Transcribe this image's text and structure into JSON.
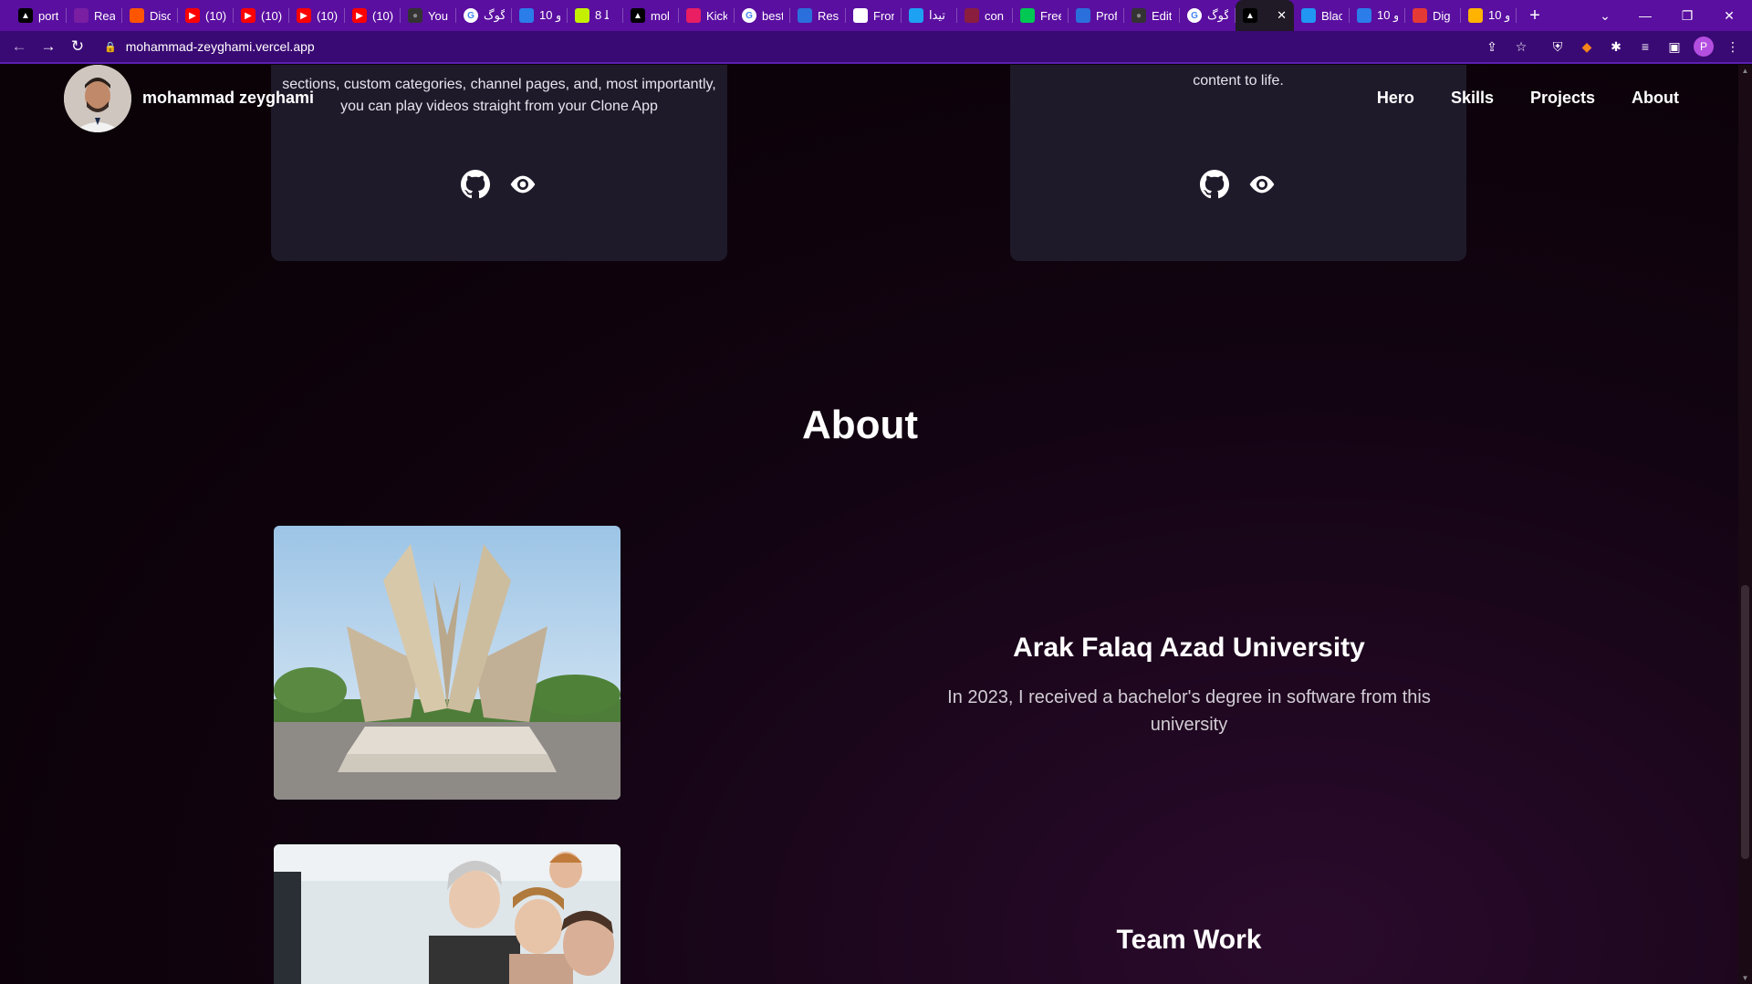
{
  "browser": {
    "tabs": [
      {
        "title": "port",
        "color": "#000000",
        "icon": "vercel-icon"
      },
      {
        "title": "Reac",
        "color": "#7a1fa2",
        "icon": "react-icon"
      },
      {
        "title": "Disc",
        "color": "#ff5500",
        "icon": "soundcloud-icon"
      },
      {
        "title": "(10)",
        "color": "#ff0000",
        "icon": "youtube-icon"
      },
      {
        "title": "(10)",
        "color": "#ff0000",
        "icon": "youtube-icon"
      },
      {
        "title": "(10)",
        "color": "#ff0000",
        "icon": "youtube-icon"
      },
      {
        "title": "(10)",
        "color": "#ff0000",
        "icon": "youtube-icon"
      },
      {
        "title": "You",
        "color": "#333333",
        "icon": "github-icon"
      },
      {
        "title": "گوگ",
        "color": "#ffffff",
        "icon": "google-icon"
      },
      {
        "title": "10 ﻭ",
        "color": "#2b7de9",
        "icon": "cloud-icon"
      },
      {
        "title": "8 ﻠ",
        "color": "#c4f000",
        "icon": "app-icon"
      },
      {
        "title": "mol",
        "color": "#000000",
        "icon": "vercel-icon"
      },
      {
        "title": "Kick",
        "color": "#e91e63",
        "icon": "dribbble-icon"
      },
      {
        "title": "best",
        "color": "#ffffff",
        "icon": "google-icon"
      },
      {
        "title": "Resu",
        "color": "#2a6fdb",
        "icon": "doc-icon"
      },
      {
        "title": "Fron",
        "color": "#ffffff",
        "icon": "globe-icon"
      },
      {
        "title": "تیدا",
        "color": "#1da1f2",
        "icon": "app-icon"
      },
      {
        "title": "con",
        "color": "#8b1e3f",
        "icon": "app-icon"
      },
      {
        "title": "Free",
        "color": "#00c853",
        "icon": "app-icon"
      },
      {
        "title": "Prof",
        "color": "#2a6fdb",
        "icon": "doc-icon"
      },
      {
        "title": "Edit",
        "color": "#333333",
        "icon": "github-icon"
      },
      {
        "title": "گوگ",
        "color": "#ffffff",
        "icon": "google-icon"
      },
      {
        "title": "",
        "color": "#000000",
        "icon": "vercel-icon",
        "active": true
      },
      {
        "title": "Blac",
        "color": "#2196f3",
        "icon": "app-icon"
      },
      {
        "title": "10 ﻭ",
        "color": "#2b7de9",
        "icon": "cloud-icon"
      },
      {
        "title": "Dig",
        "color": "#e53935",
        "icon": "app-icon"
      },
      {
        "title": "10 ﻭ",
        "color": "#ffb300",
        "icon": "app-icon"
      }
    ],
    "new_tab": "+",
    "url": "mohammad-zeyghami.vercel.app",
    "profile_initial": "P"
  },
  "header": {
    "brand": "mohammad zeyghami",
    "nav": [
      "Hero",
      "Skills",
      "Projects",
      "About"
    ]
  },
  "projects": {
    "left_desc": "sections, custom categories, channel pages, and, most importantly, you can play videos straight from your Clone App",
    "right_desc": "content to life."
  },
  "about": {
    "title": "About",
    "items": [
      {
        "title": "Arak Falaq Azad University",
        "desc": "In 2023, I received a bachelor's degree in software from this university"
      },
      {
        "title": "Team Work"
      }
    ]
  },
  "colors": {
    "tabbar": "#5a0fa0",
    "addressbar": "#3a0a74",
    "page_bg": "#0b0209",
    "card_bg": "#1e1a2a"
  }
}
